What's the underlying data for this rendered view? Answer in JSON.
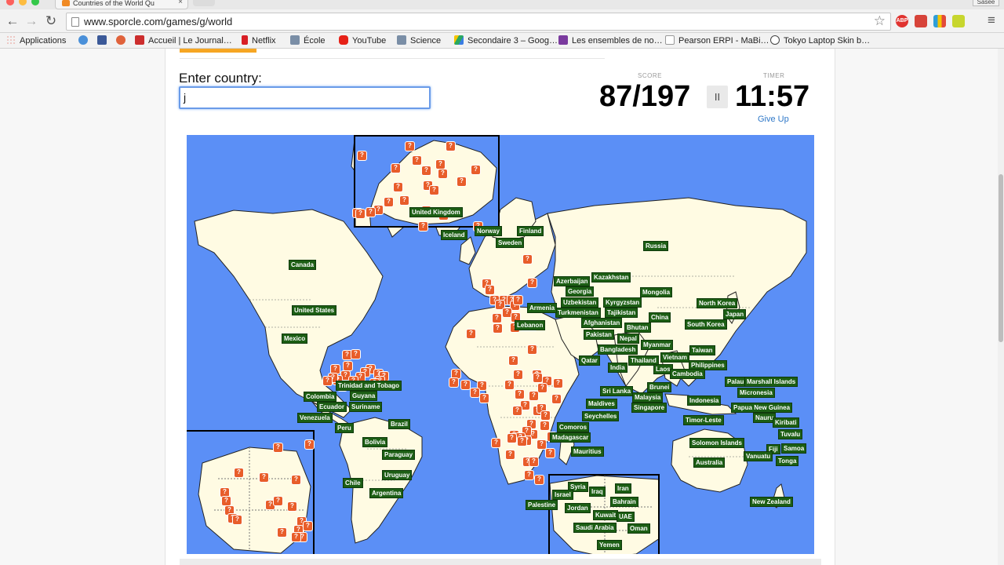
{
  "browser": {
    "tab_title": "Countries of the World Qu",
    "tab_close": "×",
    "user_tab": "Sasee",
    "url": "www.sporcle.com/games/g/world",
    "nav": {
      "back": "←",
      "forward": "→",
      "reload": "↻",
      "star": "☆",
      "menu": "≡"
    },
    "extensions": [
      "ABP"
    ]
  },
  "bookmarks": [
    {
      "label": "Applications",
      "icon": "apps-grid-icon",
      "color": "#5f8de8"
    },
    {
      "label": "",
      "icon": "chrome-icon",
      "color": "#4a90d9"
    },
    {
      "label": "",
      "icon": "facebook-icon",
      "color": "#3b5998"
    },
    {
      "label": "",
      "icon": "gimp-icon",
      "color": "#e0623b"
    },
    {
      "label": "Accueil | Le Journal…",
      "icon": "journal-icon",
      "color": "#cc2d2d"
    },
    {
      "label": "Netflix",
      "icon": "netflix-icon",
      "color": "#d81f26"
    },
    {
      "label": "École",
      "icon": "folder-icon",
      "color": "#7a8ea6"
    },
    {
      "label": "YouTube",
      "icon": "youtube-icon",
      "color": "#e62117"
    },
    {
      "label": "Science",
      "icon": "folder-icon",
      "color": "#7a8ea6"
    },
    {
      "label": "Secondaire 3 – Goog…",
      "icon": "drive-icon",
      "color": "#2aa862"
    },
    {
      "label": "Les ensembles de no…",
      "icon": "onenote-icon",
      "color": "#7a3a9e"
    },
    {
      "label": "Pearson ERPI - MaBi…",
      "icon": "page-icon",
      "color": "#c9c9c9"
    },
    {
      "label": "Tokyo Laptop Skin b…",
      "icon": "tokyo-icon",
      "color": "#444444"
    }
  ],
  "quiz": {
    "enter_label": "Enter country:",
    "input_value": "j",
    "score_label": "SCORE",
    "score": "87/197",
    "pause": "II",
    "timer_label": "TIMER",
    "timer": "11:57",
    "give_up": "Give Up"
  },
  "map": {
    "ocean_color": "#5b8ff6",
    "land_color": "#fffbe3",
    "label_color": "#1c5e14",
    "marker_color": "#e85d2a",
    "marker_glyph": "?",
    "found_countries": [
      "United Kingdom",
      "Iceland",
      "Norway",
      "Finland",
      "Sweden",
      "Russia",
      "Canada",
      "United States",
      "Mexico",
      "Trinidad and Tobago",
      "Guyana",
      "Suriname",
      "Colombia",
      "Ecuador",
      "Venezuela",
      "Peru",
      "Brazil",
      "Bolivia",
      "Paraguay",
      "Uruguay",
      "Chile",
      "Argentina",
      "Azerbaijan",
      "Kazakhstan",
      "Georgia",
      "Mongolia",
      "Uzbekistan",
      "Kyrgyzstan",
      "Turkmenistan",
      "Tajikistan",
      "Armenia",
      "Afghanistan",
      "China",
      "North Korea",
      "Japan",
      "Lebanon",
      "Bhutan",
      "South Korea",
      "Pakistan",
      "Nepal",
      "Myanmar",
      "Bangladesh",
      "Taiwan",
      "Vietnam",
      "Qatar",
      "Thailand",
      "Philippines",
      "India",
      "Laos",
      "Cambodia",
      "Brunei",
      "Palau",
      "Marshall Islands",
      "Sri Lanka",
      "Malaysia",
      "Micronesia",
      "Maldives",
      "Indonesia",
      "Singapore",
      "Papua New Guinea",
      "Seychelles",
      "Nauru",
      "Kiribati",
      "Timor-Leste",
      "Comoros",
      "Madagascar",
      "Tuvalu",
      "Solomon Islands",
      "Fiji",
      "Samoa",
      "Mauritius",
      "Vanuatu",
      "Tonga",
      "Australia",
      "New Zealand",
      "Palestine",
      "Syria",
      "Iran",
      "Israel",
      "Iraq",
      "Bahrain",
      "Jordan",
      "Kuwait",
      "UAE",
      "Saudi Arabia",
      "Oman",
      "Yemen"
    ]
  }
}
